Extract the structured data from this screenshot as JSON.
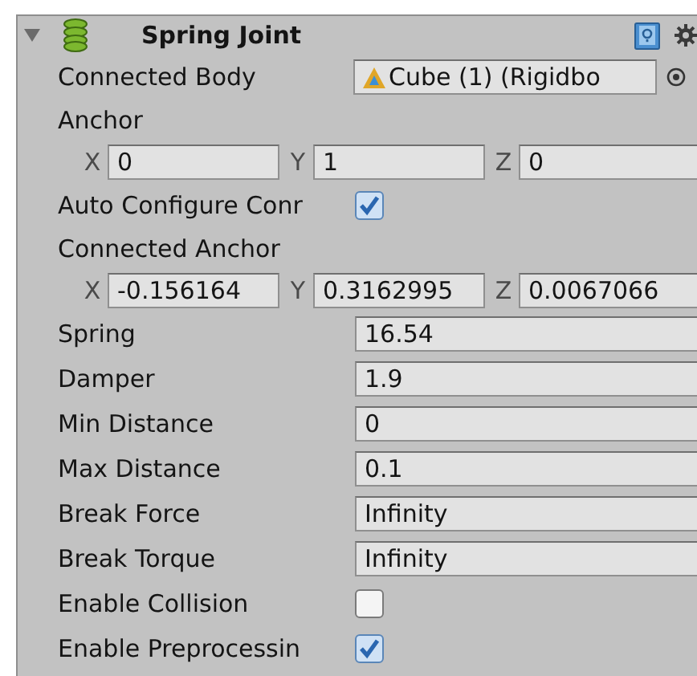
{
  "component": {
    "title": "Spring Joint",
    "expanded": true
  },
  "properties": [
    {
      "kind": "object",
      "label": "Connected Body",
      "value": "Cube (1) (Rigidbo"
    },
    {
      "kind": "vector",
      "label": "Anchor",
      "components": [
        {
          "axis": "X",
          "value": "0"
        },
        {
          "axis": "Y",
          "value": "1"
        },
        {
          "axis": "Z",
          "value": "0"
        }
      ]
    },
    {
      "kind": "toggle",
      "label": "Auto Configure Conr",
      "checked": true
    },
    {
      "kind": "vector",
      "label": "Connected Anchor",
      "components": [
        {
          "axis": "X",
          "value": "-0.156164"
        },
        {
          "axis": "Y",
          "value": "0.3162995"
        },
        {
          "axis": "Z",
          "value": "0.0067066"
        }
      ]
    },
    {
      "kind": "field",
      "label": "Spring",
      "value": "16.54"
    },
    {
      "kind": "field",
      "label": "Damper",
      "value": "1.9"
    },
    {
      "kind": "field",
      "label": "Min Distance",
      "value": "0"
    },
    {
      "kind": "field",
      "label": "Max Distance",
      "value": "0.1"
    },
    {
      "kind": "field",
      "label": "Break Force",
      "value": "Infinity"
    },
    {
      "kind": "field",
      "label": "Break Torque",
      "value": "Infinity"
    },
    {
      "kind": "toggle",
      "label": "Enable Collision",
      "checked": false
    },
    {
      "kind": "toggle",
      "label": "Enable Preprocessin",
      "checked": true
    }
  ]
}
